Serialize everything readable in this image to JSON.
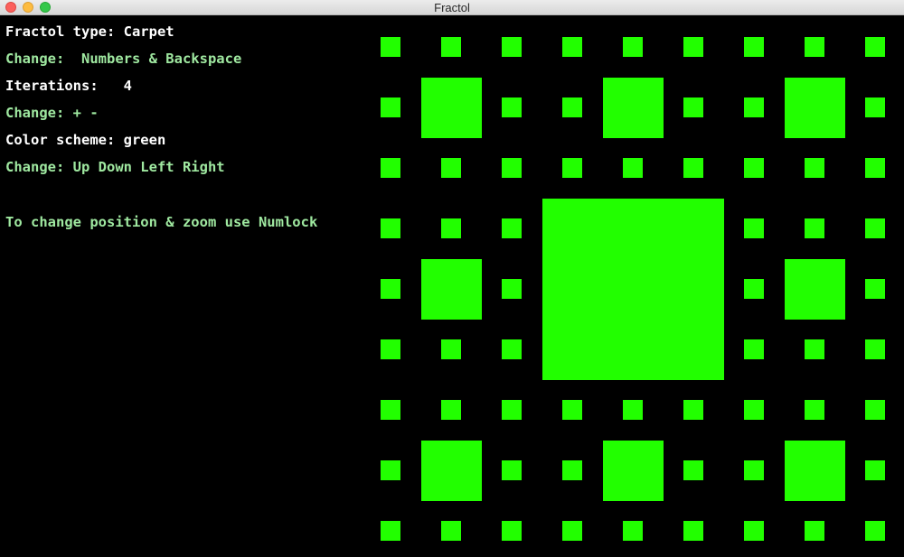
{
  "window": {
    "title": "Fractol"
  },
  "info": {
    "fractal_type": "Fractol type: Carpet",
    "fractal_change": "Change:  Numbers & Backspace",
    "iterations": "Iterations:   4",
    "iterations_change": "Change: + -",
    "color_scheme": "Color scheme: green",
    "color_change": "Change: Up Down Left Right",
    "navigation_hint": "To change position & zoom use Numlock"
  },
  "colors": {
    "background": "#000000",
    "fractal_fill": "#22ff00",
    "text_primary": "#ffffff",
    "text_hint": "#9fe8a0"
  },
  "fractal": {
    "type": "sierpinski-carpet",
    "color_scheme": "green"
  }
}
